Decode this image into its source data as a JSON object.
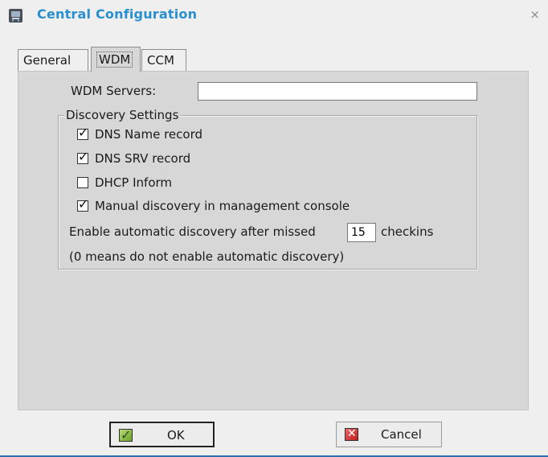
{
  "window": {
    "title": "Central Configuration",
    "close_symbol": "×",
    "icon": "app-icon"
  },
  "tabs": [
    {
      "label": "General",
      "mnemonic": "G"
    },
    {
      "label": "WDM",
      "mnemonic": "D",
      "active": true
    },
    {
      "label": "CCM",
      "mnemonic": "M"
    }
  ],
  "wdm": {
    "servers_label": "WDM Servers:",
    "servers_value": ""
  },
  "discovery": {
    "legend": "Discovery Settings",
    "checkboxes": [
      {
        "label": "DNS Name record",
        "checked": true
      },
      {
        "label": "DNS SRV record",
        "checked": true
      },
      {
        "label": "DHCP Inform",
        "checked": false
      },
      {
        "label": "Manual discovery in management console",
        "checked": true
      }
    ],
    "auto_prefix": "Enable automatic discovery after missed",
    "auto_value": "15",
    "auto_suffix": "checkins",
    "note": "(0 means do not enable automatic discovery)"
  },
  "buttons": {
    "ok": "OK",
    "cancel": "Cancel"
  },
  "colors": {
    "title": "#2a8fce",
    "panel": "#d7d7d7",
    "accent_line": "#2b6fae"
  }
}
